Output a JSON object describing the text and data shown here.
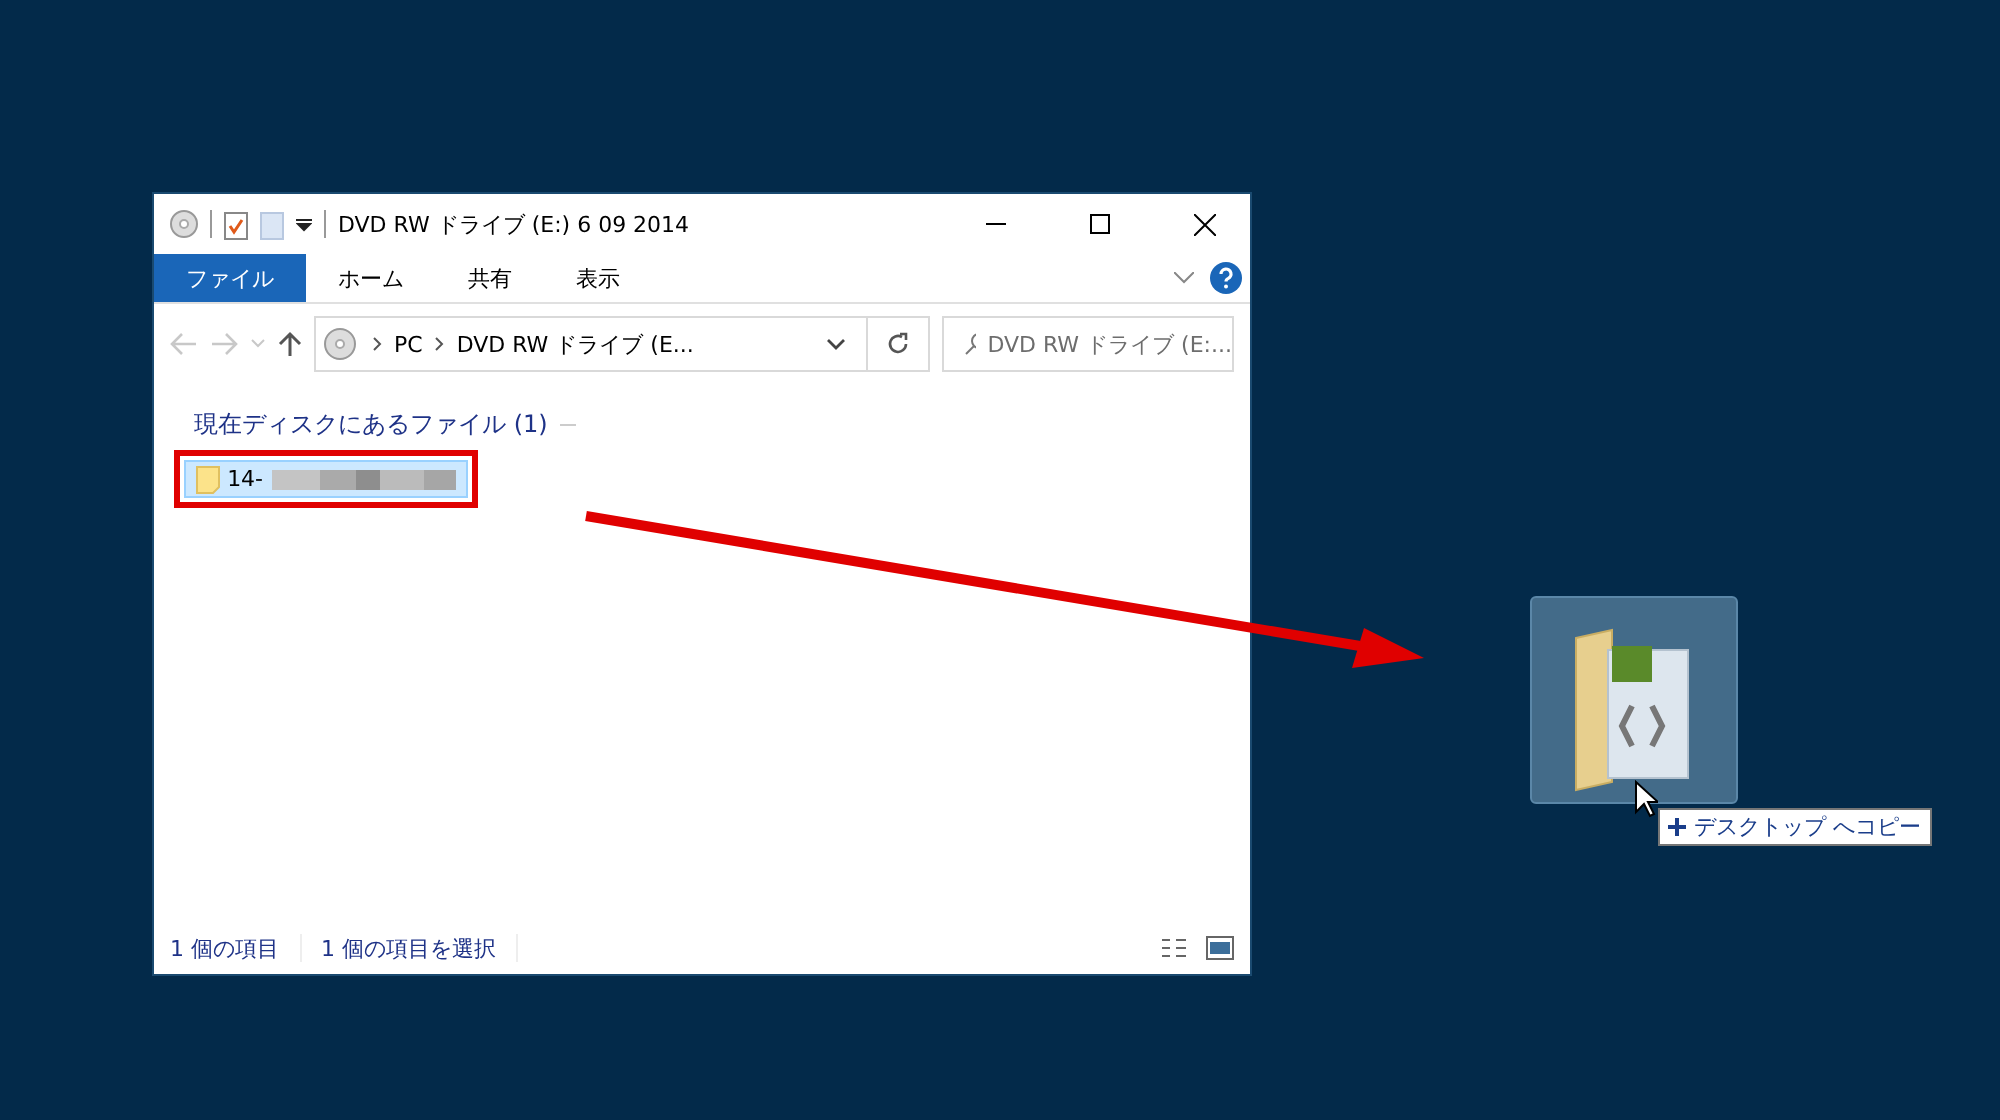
{
  "window": {
    "title": "DVD RW ドライブ (E:) 6 09 2014"
  },
  "ribbon_tabs": [
    {
      "label": "ファイル",
      "selected": true
    },
    {
      "label": "ホーム",
      "selected": false
    },
    {
      "label": "共有",
      "selected": false
    },
    {
      "label": "表示",
      "selected": false
    }
  ],
  "address": {
    "breadcrumb": [
      "PC",
      "DVD RW ドライブ (E..."
    ]
  },
  "search": {
    "placeholder": "DVD RW ドライブ (E:..."
  },
  "group_header": "現在ディスクにあるファイル (1)",
  "files": [
    {
      "name": "14-",
      "selected": true
    }
  ],
  "status_bar": [
    "1 個の項目",
    "1 個の項目を選択"
  ],
  "drag_tooltip": "デスクトップ へコピー"
}
